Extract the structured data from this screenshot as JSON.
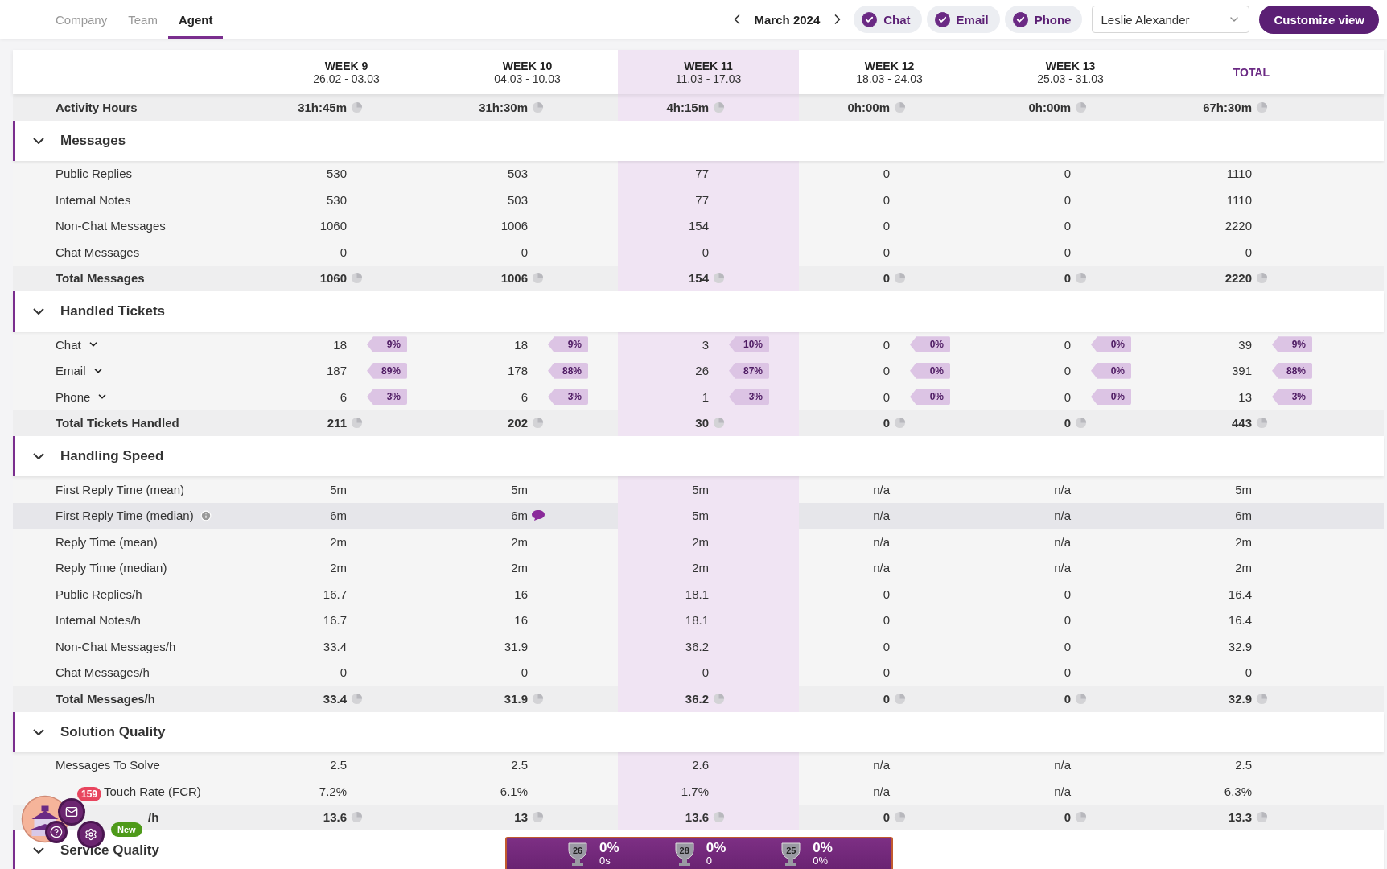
{
  "nav": {
    "tabs": [
      {
        "label": "Company",
        "selected": false
      },
      {
        "label": "Team",
        "selected": false
      },
      {
        "label": "Agent",
        "selected": true
      }
    ]
  },
  "period": {
    "label": "March 2024"
  },
  "channels": [
    {
      "label": "Chat",
      "checked": true
    },
    {
      "label": "Email",
      "checked": true
    },
    {
      "label": "Phone",
      "checked": true
    }
  ],
  "agent_select": {
    "value": "Leslie Alexander"
  },
  "customize_button": "Customize view",
  "table": {
    "columns": [
      {
        "title": "WEEK 9",
        "range": "26.02 - 03.03",
        "selected": false,
        "kind": "week"
      },
      {
        "title": "WEEK 10",
        "range": "04.03 - 10.03",
        "selected": false,
        "kind": "week"
      },
      {
        "title": "WEEK 11",
        "range": "11.03 - 17.03",
        "selected": true,
        "kind": "week"
      },
      {
        "title": "WEEK 12",
        "range": "18.03 - 24.03",
        "selected": false,
        "kind": "week"
      },
      {
        "title": "WEEK 13",
        "range": "25.03 - 31.03",
        "selected": false,
        "kind": "week"
      },
      {
        "title": "TOTAL",
        "selected": false,
        "kind": "total"
      }
    ],
    "summary": {
      "label": "Activity Hours",
      "kind": "total",
      "values": [
        "31h:45m",
        "31h:30m",
        "4h:15m",
        "0h:00m",
        "0h:00m",
        "67h:30m"
      ]
    },
    "sections": [
      {
        "title": "Messages",
        "expanded": true,
        "rows": [
          {
            "label": "Public Replies",
            "kind": "plain",
            "values": [
              "530",
              "503",
              "77",
              "0",
              "0",
              "1110"
            ]
          },
          {
            "label": "Internal Notes",
            "kind": "plain",
            "values": [
              "530",
              "503",
              "77",
              "0",
              "0",
              "1110"
            ]
          },
          {
            "label": "Non-Chat Messages",
            "kind": "plain",
            "values": [
              "1060",
              "1006",
              "154",
              "0",
              "0",
              "2220"
            ]
          },
          {
            "label": "Chat Messages",
            "kind": "plain",
            "values": [
              "0",
              "0",
              "0",
              "0",
              "0",
              "0"
            ]
          },
          {
            "label": "Total Messages",
            "kind": "total",
            "values": [
              "1060",
              "1006",
              "154",
              "0",
              "0",
              "2220"
            ]
          }
        ]
      },
      {
        "title": "Handled Tickets",
        "expanded": true,
        "rows": [
          {
            "label": "Chat",
            "kind": "channel",
            "values": [
              "18",
              "18",
              "3",
              "0",
              "0",
              "39"
            ],
            "shares": [
              "9%",
              "9%",
              "10%",
              "0%",
              "0%",
              "9%"
            ]
          },
          {
            "label": "Email",
            "kind": "channel",
            "values": [
              "187",
              "178",
              "26",
              "0",
              "0",
              "391"
            ],
            "shares": [
              "89%",
              "88%",
              "87%",
              "0%",
              "0%",
              "88%"
            ]
          },
          {
            "label": "Phone",
            "kind": "channel",
            "values": [
              "6",
              "6",
              "1",
              "0",
              "0",
              "13"
            ],
            "shares": [
              "3%",
              "3%",
              "3%",
              "0%",
              "0%",
              "3%"
            ]
          },
          {
            "label": "Total Tickets Handled",
            "kind": "total",
            "values": [
              "211",
              "202",
              "30",
              "0",
              "0",
              "443"
            ]
          }
        ]
      },
      {
        "title": "Handling Speed",
        "expanded": true,
        "rows": [
          {
            "label": "First Reply Time (mean)",
            "kind": "plain",
            "values": [
              "5m",
              "5m",
              "5m",
              "n/a",
              "n/a",
              "5m"
            ]
          },
          {
            "label": "First Reply Time (median)",
            "kind": "plain",
            "info": true,
            "hovered": true,
            "values": [
              "6m",
              {
                "text": "6m",
                "comment": true
              },
              "5m",
              "n/a",
              "n/a",
              "6m"
            ]
          },
          {
            "label": "Reply Time (mean)",
            "kind": "plain",
            "values": [
              "2m",
              "2m",
              "2m",
              "n/a",
              "n/a",
              "2m"
            ]
          },
          {
            "label": "Reply Time (median)",
            "kind": "plain",
            "values": [
              "2m",
              "2m",
              "2m",
              "n/a",
              "n/a",
              "2m"
            ]
          },
          {
            "label": "Public Replies/h",
            "kind": "plain",
            "values": [
              "16.7",
              "16",
              "18.1",
              "0",
              "0",
              "16.4"
            ]
          },
          {
            "label": "Internal Notes/h",
            "kind": "plain",
            "values": [
              "16.7",
              "16",
              "18.1",
              "0",
              "0",
              "16.4"
            ]
          },
          {
            "label": "Non-Chat Messages/h",
            "kind": "plain",
            "values": [
              "33.4",
              "31.9",
              "36.2",
              "0",
              "0",
              "32.9"
            ]
          },
          {
            "label": "Chat Messages/h",
            "kind": "plain",
            "values": [
              "0",
              "0",
              "0",
              "0",
              "0",
              "0"
            ]
          },
          {
            "label": "Total Messages/h",
            "kind": "total",
            "values": [
              "33.4",
              "31.9",
              "36.2",
              "0",
              "0",
              "32.9"
            ]
          }
        ]
      },
      {
        "title": "Solution Quality",
        "expanded": true,
        "rows": [
          {
            "label": "Messages To Solve",
            "kind": "plain",
            "values": [
              "2.5",
              "2.5",
              "2.6",
              "n/a",
              "n/a",
              "2.5"
            ]
          },
          {
            "label": "Touch Rate (FCR)",
            "kind": "obscured",
            "values": [
              "7.2%",
              "6.1%",
              "1.7%",
              "n/a",
              "n/a",
              "6.3%"
            ]
          },
          {
            "label": "/h",
            "kind": "obscured-total",
            "values": [
              "13.6",
              "13",
              "13.6",
              "0",
              "0",
              "13.3"
            ]
          }
        ]
      },
      {
        "title": "Service Quality",
        "expanded": true
      }
    ]
  },
  "widget": {
    "badge": "159",
    "new_label": "New"
  },
  "achievements": [
    {
      "trophy": "26",
      "value": "0%",
      "sub": "0s"
    },
    {
      "trophy": "28",
      "value": "0%",
      "sub": "0"
    },
    {
      "trophy": "25",
      "value": "0%",
      "sub": "0%"
    }
  ]
}
